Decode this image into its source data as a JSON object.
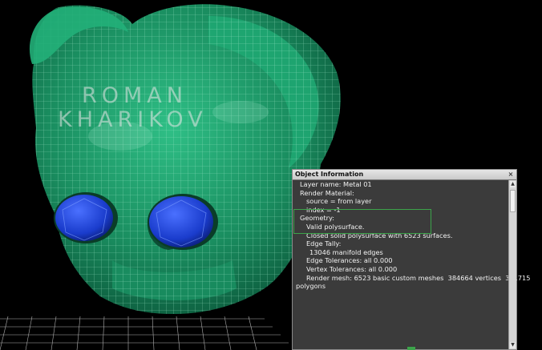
{
  "watermark": {
    "line1": "ROMAN",
    "line2": "KHARIKOV"
  },
  "panel": {
    "title": "Object Information",
    "close_icon": "×",
    "lines": [
      "Layer name: Metal 01",
      "Render Material:",
      "source = from layer",
      "index = -1",
      "Geometry:",
      "Valid polysurface.",
      "Closed solid polysurface with 6523 surfaces.",
      "Edge Tally:",
      "13046 manifold edges",
      "Edge Tolerances: all 0.000",
      "Vertex Tolerances: all 0.000",
      "Render mesh: 6523 basic custom meshes  384664 vertices  381715",
      "polygons"
    ],
    "highlight_color": "#3ca34a"
  },
  "scroll": {
    "up_icon": "▲",
    "down_icon": "▼"
  },
  "colors": {
    "model": "#1f9a6a",
    "eyes": "#1a3ccc",
    "background": "#000000"
  }
}
